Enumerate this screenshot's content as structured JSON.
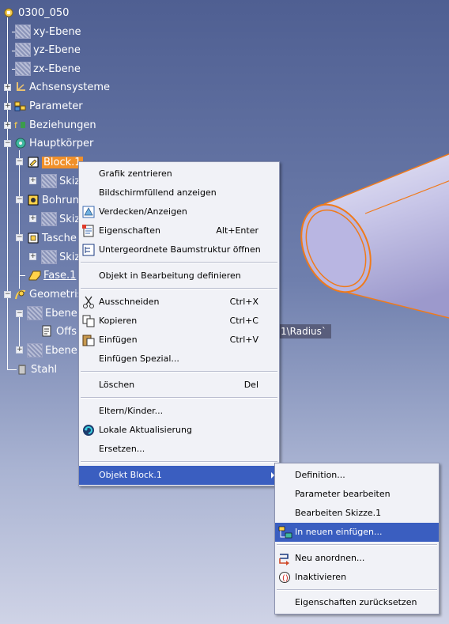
{
  "tree": {
    "root": "0300_050",
    "items": [
      {
        "label": "xy-Ebene"
      },
      {
        "label": "yz-Ebene"
      },
      {
        "label": "zx-Ebene"
      },
      {
        "label": "Achsensysteme"
      },
      {
        "label": "Parameter"
      },
      {
        "label": "Beziehungen"
      },
      {
        "label": "Hauptkörper"
      },
      {
        "label": "Block.1"
      },
      {
        "label": "Skizz"
      },
      {
        "label": "Bohrun"
      },
      {
        "label": "Skizz"
      },
      {
        "label": "Tasche"
      },
      {
        "label": "Skizz"
      },
      {
        "label": "Fase.1"
      },
      {
        "label": "Geometris"
      },
      {
        "label": "Ebene."
      },
      {
        "label": "Offs"
      },
      {
        "label": "Ebene."
      },
      {
        "label": "Stahl"
      }
    ],
    "offset_text": "1\\Radius`"
  },
  "context_menu": {
    "items": [
      {
        "label": "Grafik zentrieren",
        "shortcut": "",
        "icon": ""
      },
      {
        "label": "Bildschirmfüllend anzeigen",
        "shortcut": "",
        "icon": ""
      },
      {
        "label": "Verdecken/Anzeigen",
        "shortcut": "",
        "icon": "hide-show-icon"
      },
      {
        "label": "Eigenschaften",
        "shortcut": "Alt+Enter",
        "icon": "properties-icon"
      },
      {
        "label": "Untergeordnete Baumstruktur öffnen",
        "shortcut": "",
        "icon": "tree-icon"
      },
      {
        "label": "Objekt in Bearbeitung definieren",
        "shortcut": "",
        "icon": ""
      },
      {
        "label": "Ausschneiden",
        "shortcut": "Ctrl+X",
        "icon": "scissors-icon"
      },
      {
        "label": "Kopieren",
        "shortcut": "Ctrl+C",
        "icon": "copy-icon"
      },
      {
        "label": "Einfügen",
        "shortcut": "Ctrl+V",
        "icon": "paste-icon"
      },
      {
        "label": "Einfügen Spezial...",
        "shortcut": "",
        "icon": ""
      },
      {
        "label": "Löschen",
        "shortcut": "Del",
        "icon": ""
      },
      {
        "label": "Eltern/Kinder...",
        "shortcut": "",
        "icon": ""
      },
      {
        "label": "Lokale Aktualisierung",
        "shortcut": "",
        "icon": "update-icon"
      },
      {
        "label": "Ersetzen...",
        "shortcut": "",
        "icon": ""
      },
      {
        "label": "Objekt Block.1",
        "shortcut": "",
        "icon": ""
      }
    ]
  },
  "submenu": {
    "items": [
      {
        "label": "Definition...",
        "icon": ""
      },
      {
        "label": "Parameter bearbeiten",
        "icon": ""
      },
      {
        "label": "Bearbeiten Skizze.1",
        "icon": ""
      },
      {
        "label": "In neuen einfügen...",
        "icon": "insert-new-icon"
      },
      {
        "label": "Neu anordnen...",
        "icon": "reorder-icon"
      },
      {
        "label": "Inaktivieren",
        "icon": "deactivate-icon"
      },
      {
        "label": "Eigenschaften zurücksetzen",
        "icon": ""
      }
    ]
  },
  "colors": {
    "selection": "#f0902a",
    "menu_highlight": "#3a5ec0",
    "cylinder_edge": "#f07a1a"
  }
}
